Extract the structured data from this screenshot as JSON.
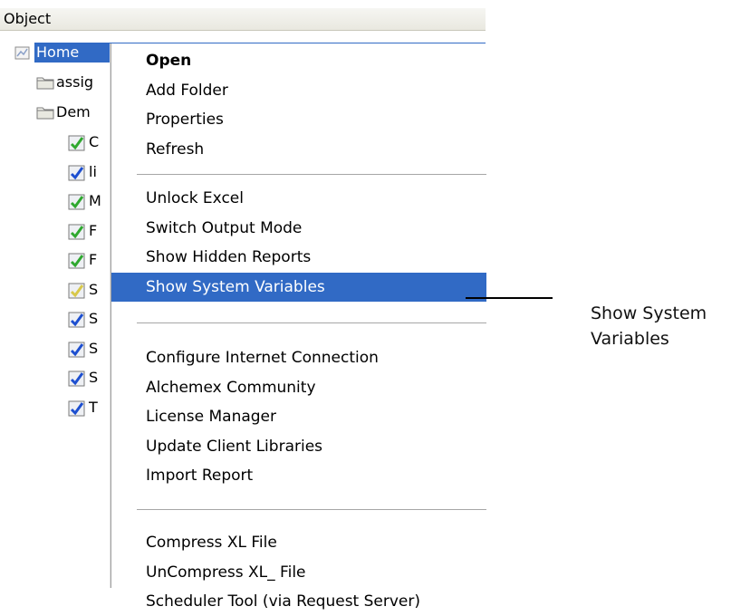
{
  "header": {
    "column_label": "Object"
  },
  "tree": {
    "root_label": "Home",
    "folders": [
      "assig",
      "Dem"
    ],
    "reports": [
      {
        "label": "C",
        "icon": "report-green-check-icon"
      },
      {
        "label": "li",
        "icon": "report-blue-check-icon"
      },
      {
        "label": "M",
        "icon": "report-green-check-icon"
      },
      {
        "label": "F",
        "icon": "report-green-check-icon"
      },
      {
        "label": "F",
        "icon": "report-green-check-icon"
      },
      {
        "label": "S",
        "icon": "report-yellow-check-icon"
      },
      {
        "label": "S",
        "icon": "report-blue-check-icon"
      },
      {
        "label": "S",
        "icon": "report-blue-check-icon"
      },
      {
        "label": "S",
        "icon": "report-blue-check-icon"
      },
      {
        "label": "T",
        "icon": "report-blue-check-icon"
      }
    ]
  },
  "context_menu": {
    "groups": [
      [
        "Open",
        "Add Folder",
        "Properties",
        "Refresh"
      ],
      [
        "Unlock Excel",
        "Switch Output Mode",
        "Show Hidden Reports",
        "Show System Variables"
      ],
      [
        "Configure Internet Connection",
        "Alchemex Community",
        "License Manager",
        "Update Client Libraries",
        "Import Report"
      ],
      [
        "Compress XL File",
        "UnCompress XL_ File",
        "Scheduler Tool (via Request Server)"
      ]
    ],
    "selected_item": "Show System Variables",
    "default_item": "Open"
  },
  "callout": {
    "text_line1": "Show System",
    "text_line2": "Variables"
  },
  "colors": {
    "selection": "#316ac5",
    "header_bg": "#eceae0"
  }
}
